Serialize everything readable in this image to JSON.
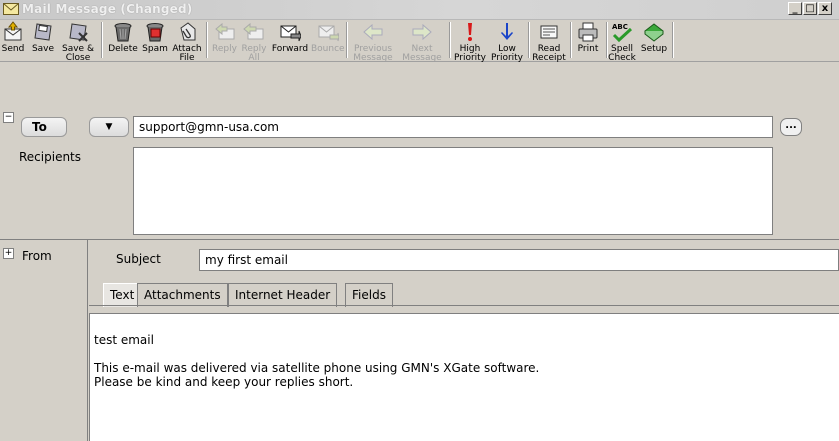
{
  "window": {
    "title": "Mail Message (Changed)",
    "controls": [
      "_",
      "□",
      "x"
    ]
  },
  "toolbar": {
    "buttons": [
      {
        "label": "Send",
        "icon": "send-icon",
        "enabled": true
      },
      {
        "label": "Save",
        "icon": "save-icon",
        "enabled": true
      },
      {
        "label": "Save &\nClose",
        "icon": "save-close-icon",
        "enabled": true
      },
      {
        "label": "Delete",
        "icon": "trash-icon",
        "enabled": true
      },
      {
        "label": "Spam",
        "icon": "spam-icon",
        "enabled": true
      },
      {
        "label": "Attach\nFile",
        "icon": "paperclip-icon",
        "enabled": true
      },
      {
        "label": "Reply",
        "icon": "reply-icon",
        "enabled": false
      },
      {
        "label": "Reply\nAll",
        "icon": "reply-all-icon",
        "enabled": false
      },
      {
        "label": "Forward",
        "icon": "forward-icon",
        "enabled": true
      },
      {
        "label": "Bounce",
        "icon": "bounce-icon",
        "enabled": false
      },
      {
        "label": "Previous\nMessage",
        "icon": "arrow-left-icon",
        "enabled": false
      },
      {
        "label": "Next\nMessage",
        "icon": "arrow-right-icon",
        "enabled": false
      },
      {
        "label": "High\nPriority",
        "icon": "high-priority-icon",
        "enabled": true
      },
      {
        "label": "Low\nPriority",
        "icon": "low-priority-icon",
        "enabled": true
      },
      {
        "label": "Read\nReceipt",
        "icon": "read-receipt-icon",
        "enabled": true
      },
      {
        "label": "Print",
        "icon": "printer-icon",
        "enabled": true
      },
      {
        "label": "Spell\nCheck",
        "icon": "spell-check-icon",
        "enabled": true
      },
      {
        "label": "Setup",
        "icon": "setup-icon",
        "enabled": true
      }
    ]
  },
  "header": {
    "to_button": "To",
    "to_dropdown": "▼",
    "to_value": "support@gmn-usa.com",
    "recipients_label": "Recipients",
    "more_button": "...",
    "collapse_toggle": "−",
    "expand_toggle": "+",
    "from_label": "From",
    "subject_label": "Subject",
    "subject_value": "my first email"
  },
  "tabs": [
    "Text",
    "Attachments",
    "Internet Header",
    "Fields"
  ],
  "body": {
    "line1": "test email",
    "line2": "This e-mail was delivered via satellite phone using GMN's XGate software.",
    "line3": "Please be kind and keep your replies short."
  },
  "colors": {
    "title_bar": "#c8c8c8",
    "window": "#d4d0c8",
    "high_priority": "#d81818",
    "low_priority": "#1a44c8"
  }
}
